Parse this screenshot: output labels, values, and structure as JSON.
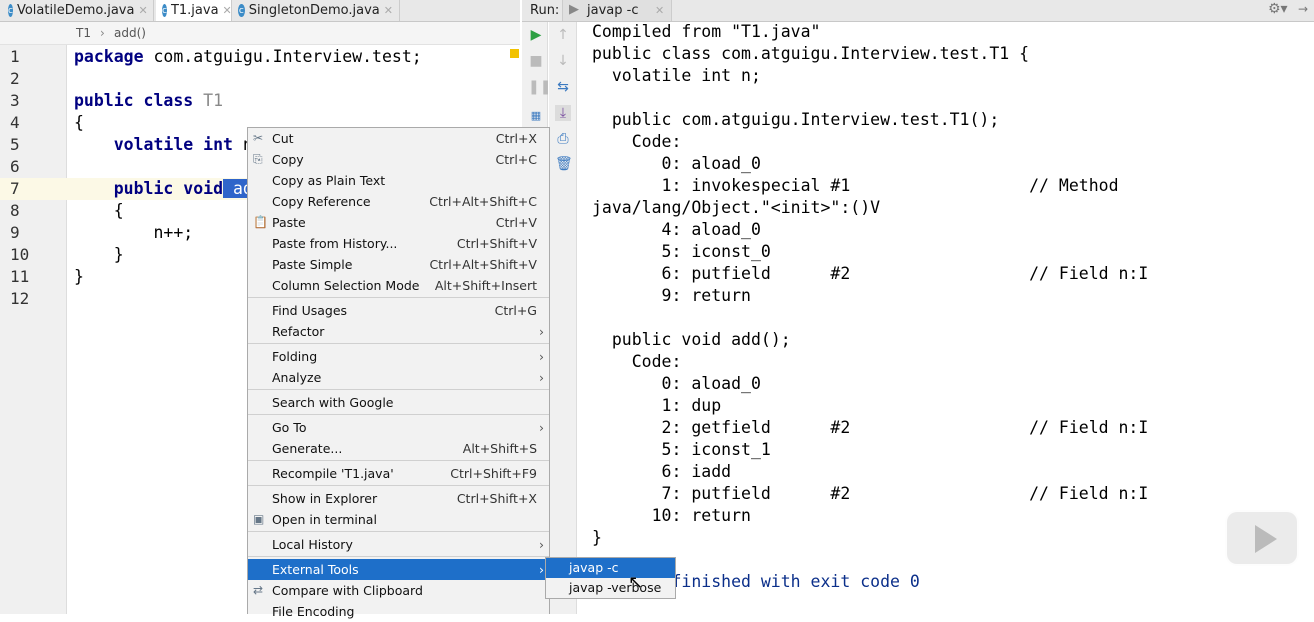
{
  "editor": {
    "tabs": [
      {
        "label": "VolatileDemo.java",
        "active": false
      },
      {
        "label": "T1.java",
        "active": true
      },
      {
        "label": "SingletonDemo.java",
        "active": false
      }
    ],
    "breadcrumb": [
      "T1",
      "add()"
    ],
    "line_numbers": [
      "1",
      "2",
      "3",
      "4",
      "5",
      "6",
      "7",
      "8",
      "9",
      "10",
      "11",
      "12"
    ],
    "lines": {
      "l1a": "package",
      "l1b": " com.atguigu.Interview.test;",
      "l3a": "public class",
      "l3b": " T1",
      "l4": "{",
      "l5a": "    volatile int",
      "l5b": " n;",
      "l7a": "    public void",
      "l7b": " add",
      "l7c": "() {",
      "l8": "    {",
      "l9": "        n++;",
      "l10": "    }",
      "l11": "}"
    }
  },
  "run": {
    "label": "Run:",
    "tab": "javap -c",
    "output": [
      "Compiled from \"T1.java\"",
      "public class com.atguigu.Interview.test.T1 {",
      "  volatile int n;",
      "",
      "  public com.atguigu.Interview.test.T1();",
      "    Code:",
      "       0: aload_0",
      "       1: invokespecial #1                  // Method java/lang/Object.\"<init>\":()V",
      "       4: aload_0",
      "       5: iconst_0",
      "       6: putfield      #2                  // Field n:I",
      "       9: return",
      "",
      "  public void add();",
      "    Code:",
      "       0: aload_0",
      "       1: dup",
      "       2: getfield      #2                  // Field n:I",
      "       5: iconst_1",
      "       6: iadd",
      "       7: putfield      #2                  // Field n:I",
      "      10: return",
      "}",
      "",
      "Process finished with exit code 0"
    ]
  },
  "context_menu": {
    "items": [
      {
        "label": "Cut",
        "shortcut": "Ctrl+X",
        "icon": "scissors-icon"
      },
      {
        "label": "Copy",
        "shortcut": "Ctrl+C",
        "icon": "copy-icon"
      },
      {
        "label": "Copy as Plain Text",
        "shortcut": ""
      },
      {
        "label": "Copy Reference",
        "shortcut": "Ctrl+Alt+Shift+C"
      },
      {
        "label": "Paste",
        "shortcut": "Ctrl+V",
        "icon": "paste-icon"
      },
      {
        "label": "Paste from History...",
        "shortcut": "Ctrl+Shift+V"
      },
      {
        "label": "Paste Simple",
        "shortcut": "Ctrl+Alt+Shift+V"
      },
      {
        "label": "Column Selection Mode",
        "shortcut": "Alt+Shift+Insert"
      },
      {
        "sep": true
      },
      {
        "label": "Find Usages",
        "shortcut": "Ctrl+G"
      },
      {
        "label": "Refactor",
        "submenu": true
      },
      {
        "sep": true
      },
      {
        "label": "Folding",
        "submenu": true
      },
      {
        "label": "Analyze",
        "submenu": true
      },
      {
        "sep": true
      },
      {
        "label": "Search with Google"
      },
      {
        "sep": true
      },
      {
        "label": "Go To",
        "submenu": true
      },
      {
        "label": "Generate...",
        "shortcut": "Alt+Shift+S"
      },
      {
        "sep": true
      },
      {
        "label": "Recompile 'T1.java'",
        "shortcut": "Ctrl+Shift+F9"
      },
      {
        "sep": true
      },
      {
        "label": "Show in Explorer",
        "shortcut": "Ctrl+Shift+X"
      },
      {
        "label": "Open in terminal",
        "icon": "terminal-icon"
      },
      {
        "sep": true
      },
      {
        "label": "Local History",
        "submenu": true
      },
      {
        "sep": true
      },
      {
        "label": "External Tools",
        "submenu": true,
        "highlighted": true
      },
      {
        "label": "Compare with Clipboard",
        "icon": "compare-icon"
      },
      {
        "label": "File Encoding"
      }
    ],
    "submenu": [
      "javap -c",
      "javap -verbose"
    ]
  },
  "colors": {
    "highlight": "#1e6fc9",
    "keyword": "#000080",
    "run_green": "#2ea043"
  }
}
